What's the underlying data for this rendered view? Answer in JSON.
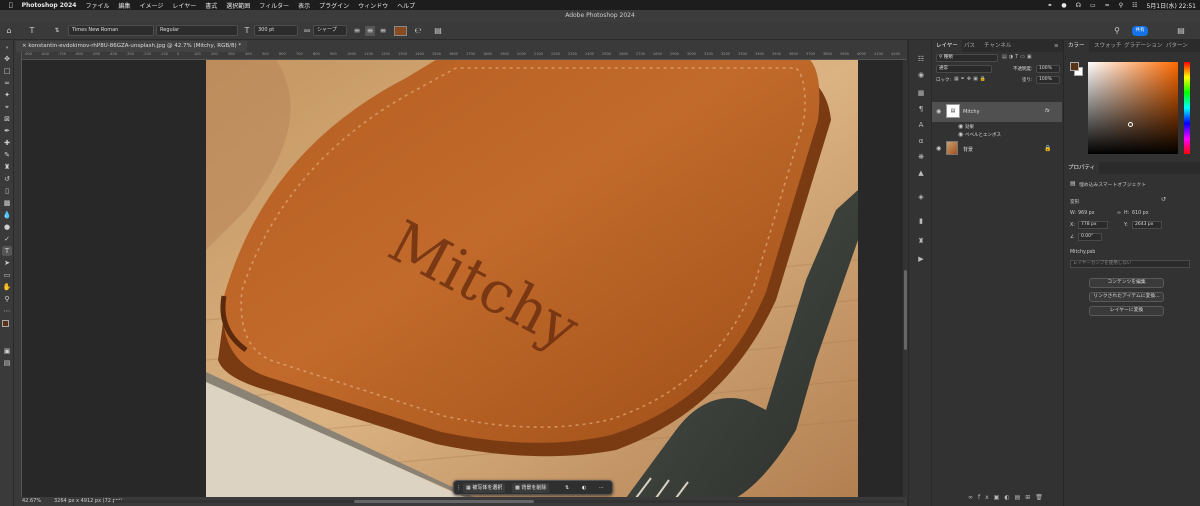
{
  "menubar": {
    "apple_icon": "apple-icon",
    "app_name": "Photoshop 2024",
    "items": [
      "ファイル",
      "編集",
      "イメージ",
      "レイヤー",
      "書式",
      "選択範囲",
      "フィルター",
      "表示",
      "プラグイン",
      "ウィンドウ",
      "ヘルプ"
    ],
    "date_time": "5月1日(水) 22:51"
  },
  "window": {
    "title": "Adobe Photoshop 2024"
  },
  "options": {
    "font_family": "Times New Roman",
    "font_style": "Regular",
    "font_size": "300 pt",
    "antialias": "シャープ",
    "text_color": "#8a4a22",
    "share_label": "共有"
  },
  "document": {
    "tab_title": "konstantin-evdokimov-rhP8U-86GZA-unsplash.jpg @ 42.7% (Mitchy, RGB/8) *",
    "canvas_text": "Mitchy"
  },
  "ruler": {
    "top_labels": [
      "-900",
      "-800",
      "-700",
      "-600",
      "-500",
      "-400",
      "-300",
      "-200",
      "-100",
      "0",
      "100",
      "200",
      "300",
      "400",
      "500",
      "600",
      "700",
      "800",
      "900",
      "1000",
      "1100",
      "1200",
      "1300",
      "1400",
      "1500",
      "1600",
      "1700",
      "1800",
      "1900",
      "2000",
      "2100",
      "2200",
      "2300",
      "2400",
      "2500",
      "2600",
      "2700",
      "2800",
      "2900",
      "3000",
      "3100",
      "3200",
      "3300",
      "3400",
      "3500",
      "3600",
      "3700",
      "3800",
      "3900",
      "4000",
      "4100",
      "4200"
    ]
  },
  "status": {
    "zoom": "42.67%",
    "doc_size": "3264 px x 4912 px (72 ppi)"
  },
  "context_bar": {
    "select_subject": "被写体を選択",
    "remove_bg": "背景を削除"
  },
  "layers_panel": {
    "tabs": [
      "レイヤー",
      "パス",
      "チャンネル"
    ],
    "filter_kind": "種類",
    "blend_mode": "通常",
    "opacity_label": "不透明度:",
    "opacity_value": "100%",
    "lock_label": "ロック:",
    "fill_label": "塗り:",
    "fill_value": "100%",
    "layers": [
      {
        "name": "Mitchy",
        "fx": "fx",
        "effects_label": "効果",
        "effect": "ベベルとエンボス"
      },
      {
        "name": "背景"
      }
    ]
  },
  "color_panel": {
    "tabs": [
      "カラー",
      "スウォッチ",
      "グラデーション",
      "パターン"
    ],
    "foreground": "#5a3218"
  },
  "properties_panel": {
    "tab": "プロパティ",
    "object_type": "埋め込みスマートオブジェクト",
    "transform_label": "変形",
    "w_label": "W:",
    "w_value": "969 px",
    "h_label": "H:",
    "h_value": "610 px",
    "x_label": "X:",
    "x_value": "778 px",
    "y_label": "Y:",
    "y_value": "2643 px",
    "angle_value": "0.00°",
    "file_name": "Mitchy.psb",
    "layer_comp": "レイヤーカンプを使用しない",
    "btn_edit": "コンテンツを編集",
    "btn_convert_linked": "リンクされたアイテムに変換...",
    "btn_convert_layers": "レイヤーに変換"
  }
}
